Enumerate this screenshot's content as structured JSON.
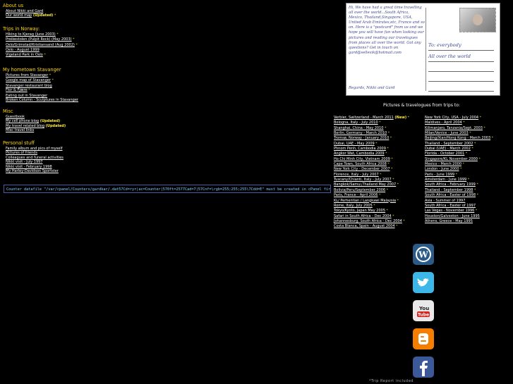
{
  "sections": [
    {
      "heading": "About us",
      "items": [
        {
          "label": "About Nikki and Gard",
          "star": false
        },
        {
          "label": "Our world map",
          "updated": "(Updated)",
          "star": true
        }
      ]
    },
    {
      "heading": "Trips in Norway:",
      "items": [
        {
          "label": "Hiking to Kjerag (June 2003)",
          "star": true
        },
        {
          "label": "Preikestolen (Pulpit Rock) (May 2003)",
          "star": true
        },
        {
          "label": "Oslo/Grimstad/Kristiansand (Aug 2002)",
          "star": true
        },
        {
          "label": "Oslo - August 1999",
          "star": false
        },
        {
          "label": "Vigeland Park in Oslo",
          "star": true
        }
      ]
    },
    {
      "heading": "My hometown Stavanger",
      "items": [
        {
          "label": "Pictures from Stavanger",
          "star": true
        },
        {
          "label": "Google map of Stavanger",
          "star": true
        },
        {
          "label": "Stavanger restaurant blog",
          "star": false
        },
        {
          "label": "Flor & Fjære",
          "star": true
        },
        {
          "label": "Eating out in Stavanger",
          "star": false
        },
        {
          "label": "Broken Column - Sculptures in Stavanger",
          "star": false
        }
      ]
    },
    {
      "heading": "Misc",
      "items": [
        {
          "label": "Guestbook",
          "star": false
        },
        {
          "label": "My cell phone blog",
          "updated": "(Updated)",
          "star": false
        },
        {
          "label": "My travel related blog",
          "updated": "(Updated)",
          "star": false
        },
        {
          "label": "Misc travel links",
          "star": false
        }
      ]
    },
    {
      "heading": "Personal stuff",
      "items": [
        {
          "label": "Family album and pics of myself",
          "star": false
        },
        {
          "label": "Pictures of friends",
          "star": false
        },
        {
          "label": "Colleagues and funeral activities",
          "star": false
        },
        {
          "label": "Nikki visit - July 1997",
          "star": false
        },
        {
          "label": "Nikki visit - February 1998",
          "star": false
        },
        {
          "label": "My Harley-Davidson Sportster",
          "star": false
        }
      ]
    }
  ],
  "counter_text": "Counter datafile \"/var/cpanel/Counters/gardkar/.dat57Cd=ryr|ac=Counter|570ft=2577Cad=7|57Cnf=\\rgb=255;255;255\\7Cdd=E\" must be created in cPanel first!",
  "postcard": {
    "message": "Hi, We have had a great time travelling all over the world...South Africa, Mexico, Thailand,Singapore, USA, United Arab Emirates,etc, France and so on. Here is a \"postcard\" from us and we hope you will have fun when looking our pictures and reading our travelogues from places all over the world. Got any questions? Get in touch on gard@sellevik@hotmail.com",
    "signature": "Regards, Nikki and Gard",
    "to_line1": "To: everybody",
    "to_line2": "All over the world"
  },
  "pics_heading": "Pictures & travelogues from trips to:",
  "trips_left": [
    {
      "label": "Verbier, Switzerland - March 2011",
      "new": "(New)",
      "star": true
    },
    {
      "label": "Bologna, Italy - July 2010",
      "star": true
    },
    {
      "label": "Shanghai, China - May 2010",
      "star": true
    },
    {
      "label": "Berlin, Germany - March 2010",
      "star": true
    },
    {
      "label": "Tromsø, Norway - January 2010",
      "star": true
    },
    {
      "label": "Dubai, UAE - May 2009",
      "star": true
    },
    {
      "label": "Phnom Penh, Cambodia 2009",
      "star": true
    },
    {
      "label": "Angkor Wat, Cambodia 2009",
      "star": true
    },
    {
      "label": "Ho Chi Minh City, Vietnam 2009",
      "star": true
    },
    {
      "label": "Cape Town, South Africa 2008",
      "star": true
    },
    {
      "label": "New York City - December 2007",
      "star": true
    },
    {
      "label": "Florence, Italy - July 2007",
      "star": true
    },
    {
      "label": "Tuscany/Chianti, Italy - July 2007",
      "star": true
    },
    {
      "label": "Bangkok/Samui,Thailand May 2007",
      "star": true
    },
    {
      "label": "Bolivia/Peru/September 2006",
      "star": true
    },
    {
      "label": "Paris, France - April 2006",
      "star": true
    },
    {
      "label": "KL/ Perhentian / Langkawi Malaysia",
      "star": true
    },
    {
      "label": "Rome, Italy, July 2005",
      "star": true
    },
    {
      "label": "Tokyo/Kyoto, Japan May 2005",
      "star": true
    },
    {
      "label": "Safari in South Africa - Dec 2004",
      "star": true
    },
    {
      "label": "Johannesburg, South Africa - Dec 2004",
      "star": true
    },
    {
      "label": "Costa Blanca, Spain - August 2004",
      "star": true
    }
  ],
  "trips_right": [
    {
      "label": "New York City, USA - July 2004",
      "star": true
    },
    {
      "label": "Maldives - April 2004",
      "star": true
    },
    {
      "label": "Kilimanjaro, Tanzania/Sept. 2003",
      "star": true
    },
    {
      "label": "Milan/Venice - June 2003",
      "star": true
    },
    {
      "label": "Beijing/Xian/Hong Kong - March 2003",
      "star": true
    },
    {
      "label": "Thailand - September 2002",
      "star": true
    },
    {
      "label": "Dubai (UAE) - March 2002",
      "star": true
    },
    {
      "label": "Florida - October 2001",
      "star": true
    },
    {
      "label": "Singapore/KL November 2000",
      "star": true
    },
    {
      "label": "Mexico - March 2000",
      "star": true
    },
    {
      "label": "London - June 2000",
      "star": true
    },
    {
      "label": "Paris - June 1999",
      "star": true
    },
    {
      "label": "Amsterdam - June 1999",
      "star": true
    },
    {
      "label": "South Africa - February 1999",
      "star": true
    },
    {
      "label": "Thailand - September 1998",
      "star": true
    },
    {
      "label": "South Africa - Easter of 1998",
      "star": true
    },
    {
      "label": "Asia - Summer of 1997",
      "star": false
    },
    {
      "label": "South Africa - Easter of 1997",
      "star": false
    },
    {
      "label": "Las Vegas - November 1996",
      "star": true
    },
    {
      "label": "Houston/Galveston - June 1995",
      "star": false
    },
    {
      "label": "Athens, Greece - May 1995",
      "star": false
    }
  ],
  "social": [
    {
      "name": "wordpress",
      "color": "#2b5a86"
    },
    {
      "name": "twitter",
      "color": "#3db6e8"
    },
    {
      "name": "youtube",
      "color": "#e9e9e9"
    },
    {
      "name": "blogger",
      "color": "#f57d00"
    },
    {
      "name": "facebook",
      "color": "#3b5998"
    }
  ],
  "report_text": "*Trip Report included",
  "star_glyph": "*"
}
